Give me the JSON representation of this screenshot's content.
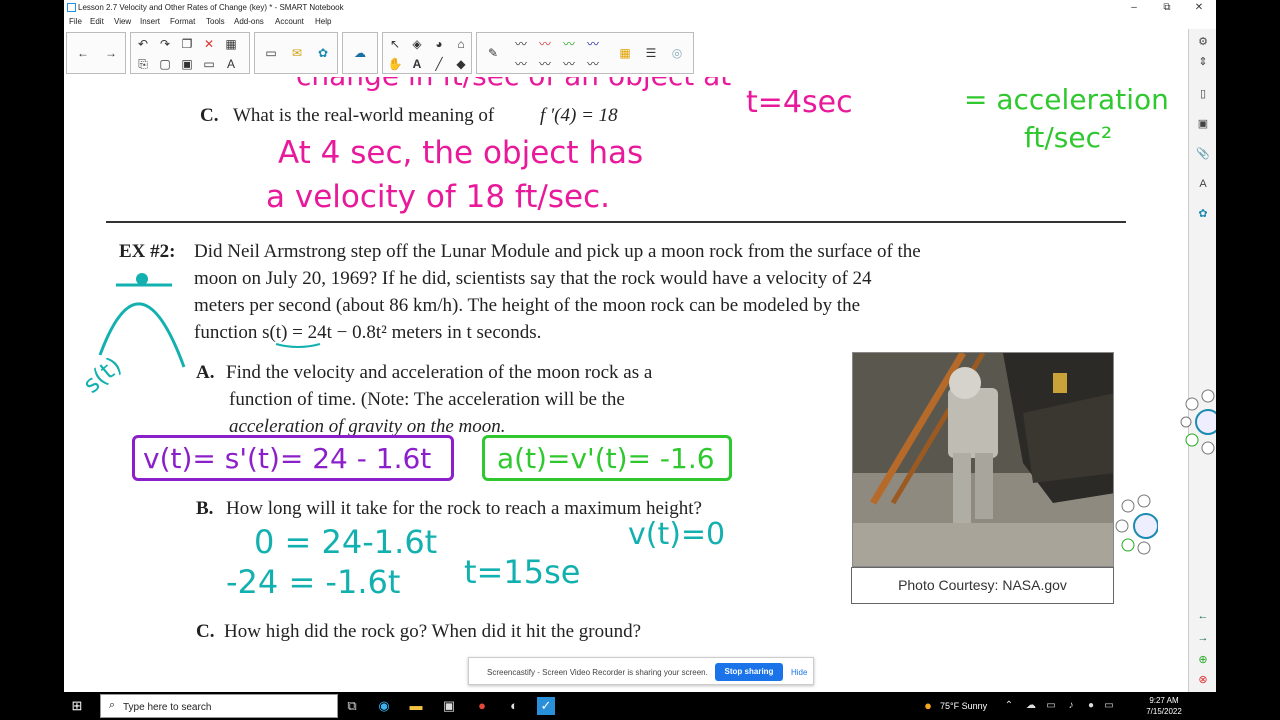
{
  "window": {
    "title": "Lesson 2.7 Velocity and Other Rates of Change (key) * - SMART Notebook",
    "controls": {
      "minimize": "–",
      "maximize": "⧉",
      "close": "✕"
    }
  },
  "menu": [
    "File",
    "Edit",
    "View",
    "Insert",
    "Format",
    "Tools",
    "Add-ons",
    "Account",
    "Help"
  ],
  "document": {
    "partC_top": "What is the real-world meaning of",
    "partC_top_label": "C.",
    "partC_top_expr": "f ′(4) = 18",
    "ex2_label": "EX #2:",
    "ex2_lines": [
      "Did Neil Armstrong step off the Lunar Module and pick up a moon rock from the surface of the",
      "moon on July 20, 1969?  If he did, scientists say that the rock would have a velocity of 24",
      "meters per second (about 86 km/h). The height of the moon rock can be modeled by the",
      "function s(t) = 24t − 0.8t² meters in t seconds."
    ],
    "partA_label": "A.",
    "partA_lines": [
      "Find the velocity and acceleration of the moon rock as a",
      "function of time. (Note: The acceleration will be the",
      "acceleration of gravity on the moon."
    ],
    "partB_label": "B.",
    "partB": "How long will it take for the rock to reach a maximum height?",
    "partC_label": "C.",
    "partC": "How high did the rock go?  When did it hit the ground?",
    "photo_caption": "Photo Courtesy: NASA.gov"
  },
  "handwriting": {
    "top_partial": "change in ft/sec of an object at",
    "t4": "t=4sec",
    "accel": "= acceleration",
    "units": "ft/sec²",
    "answer_line1": "At 4 sec, the object has",
    "answer_line2": "a velocity of 18 ft/sec.",
    "s_t": "s(t)",
    "velocity_box": "v(t)= s'(t)= 24 - 1.6t",
    "accel_box": "a(t)=v'(t)= -1.6",
    "step1": "0 = 24-1.6t",
    "step2": "-24 = -1.6t",
    "vt0": "v(t)=0",
    "t15": "t=15se"
  },
  "screencastify": {
    "message": "Screencastify - Screen Video Recorder is sharing your screen.",
    "stop": "Stop sharing",
    "hide": "Hide"
  },
  "taskbar": {
    "search_placeholder": "Type here to search",
    "weather": "75°F  Sunny",
    "time": "9:27 AM",
    "date": "7/15/2022"
  },
  "colors": {
    "magenta": "#e8199a",
    "green": "#2fc82f",
    "teal": "#13b0b0",
    "purple": "#8b1fc9"
  }
}
